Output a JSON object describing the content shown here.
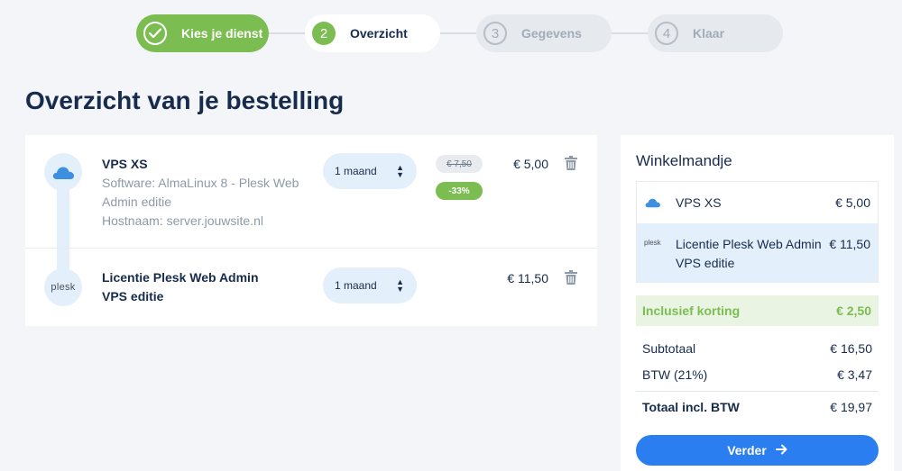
{
  "stepper": {
    "steps": [
      {
        "num": "",
        "label": "Kies je dienst",
        "state": "done"
      },
      {
        "num": "2",
        "label": "Overzicht",
        "state": "active"
      },
      {
        "num": "3",
        "label": "Gegevens",
        "state": "todo"
      },
      {
        "num": "4",
        "label": "Klaar",
        "state": "todo"
      }
    ]
  },
  "page_title": "Overzicht van je bestelling",
  "items": [
    {
      "title": "VPS XS",
      "software": "Software: AlmaLinux 8 - Plesk Web Admin editie",
      "hostname": "Hostnaam: server.jouwsite.nl",
      "period": "1 maand",
      "old_price": "€ 7,50",
      "discount": "-33%",
      "price": "€ 5,00",
      "icon": "cloud-icon"
    },
    {
      "title": "Licentie Plesk Web Admin VPS editie",
      "logo_text": "plesk",
      "period": "1 maand",
      "price": "€ 11,50",
      "icon": "plesk-logo"
    }
  ],
  "cart": {
    "title": "Winkelmandje",
    "lines": [
      {
        "name": "VPS XS",
        "price": "€ 5,00",
        "icon": "cloud-icon"
      },
      {
        "name": "Licentie Plesk Web Admin VPS editie",
        "price": "€ 11,50",
        "icon": "plesk-logo",
        "logo_text": "plesk"
      }
    ],
    "discount_label": "Inclusief korting",
    "discount_value": "€ 2,50",
    "subtotal_label": "Subtotaal",
    "subtotal_value": "€ 16,50",
    "vat_label": "BTW (21%)",
    "vat_value": "€ 3,47",
    "total_label": "Totaal incl. BTW",
    "total_value": "€ 19,97",
    "next_button": "Verder"
  },
  "colors": {
    "accent_green": "#7cbd52",
    "primary_blue": "#2b7ef0",
    "light_blue": "#e3f0fb",
    "heading": "#172b4d"
  }
}
